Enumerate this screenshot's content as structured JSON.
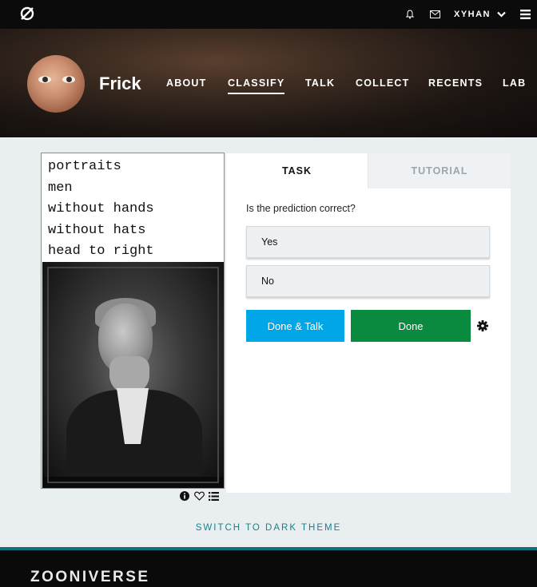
{
  "topbar": {
    "logo_icon": "zooniverse-logo-icon",
    "user_name": "XYHAN",
    "icons": [
      "bell-icon",
      "mail-icon",
      "chevron-down-icon",
      "hamburger-icon"
    ]
  },
  "project": {
    "title": "Frick",
    "nav": [
      "ABOUT",
      "CLASSIFY",
      "TALK",
      "COLLECT",
      "RECENTS",
      "LAB"
    ],
    "active_nav": "CLASSIFY"
  },
  "subject": {
    "lines": [
      "portraits",
      "men",
      "without hands",
      "without hats",
      "head to right"
    ],
    "tool_icons": [
      "info-icon",
      "heart-icon",
      "list-icon"
    ]
  },
  "task": {
    "tabs": [
      "TASK",
      "TUTORIAL"
    ],
    "question": "Is the prediction correct?",
    "answers": [
      "Yes",
      "No"
    ],
    "done_talk_label": "Done & Talk",
    "done_label": "Done",
    "colors": {
      "done_talk": "#00a6e5",
      "done": "#0a8a3f"
    }
  },
  "switch_theme": "SWITCH TO DARK THEME",
  "footer": {
    "logo_text": "ZOONIVERSE"
  }
}
